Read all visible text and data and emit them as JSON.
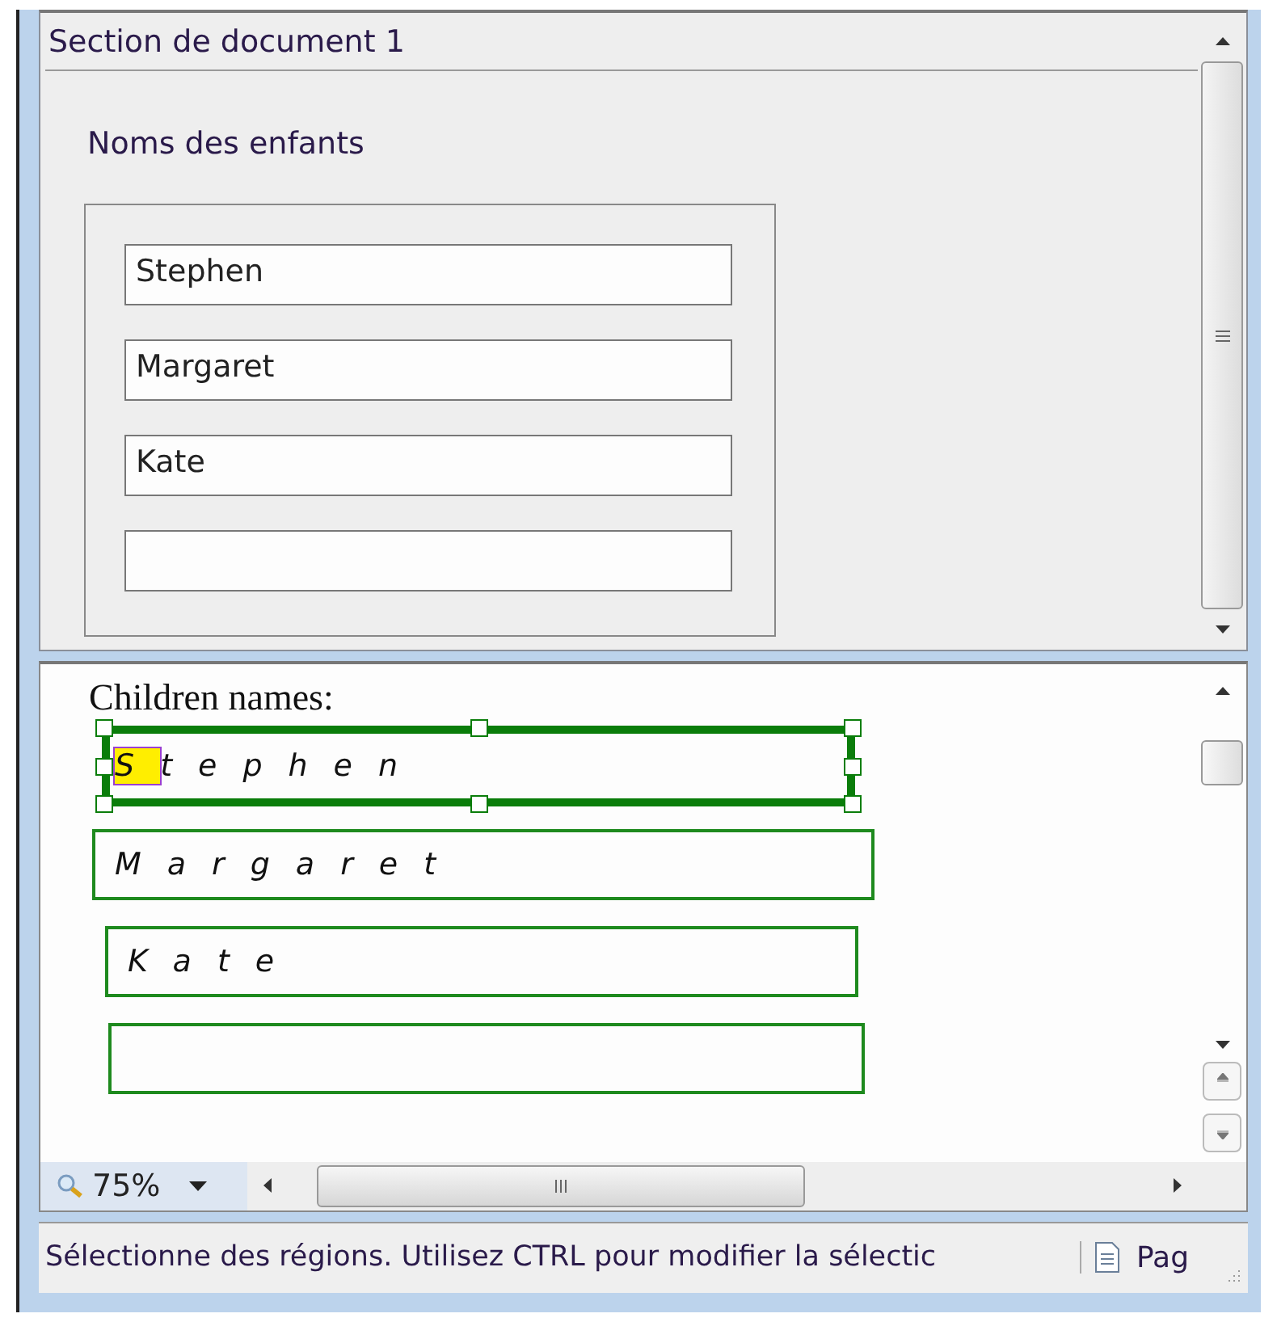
{
  "form_section": {
    "title": "Section de document 1",
    "group_label": "Noms des enfants",
    "fields": [
      {
        "kind": "text",
        "value": "Stephen"
      },
      {
        "kind": "text",
        "value": "Margaret"
      },
      {
        "kind": "text",
        "value": "Kate"
      },
      {
        "kind": "text"
      }
    ]
  },
  "ink_section": {
    "label": "Children names:",
    "fields": [
      {
        "value": "Stephen",
        "selected": true
      },
      {
        "value": "Margaret",
        "selected": false
      },
      {
        "value": "Kate",
        "selected": false
      },
      {
        "selected": false
      }
    ],
    "zoom": "75%"
  },
  "status_bar": {
    "message": "Sélectionne des régions. Utilisez CTRL pour modifier la sélectic",
    "page": "Pag"
  }
}
